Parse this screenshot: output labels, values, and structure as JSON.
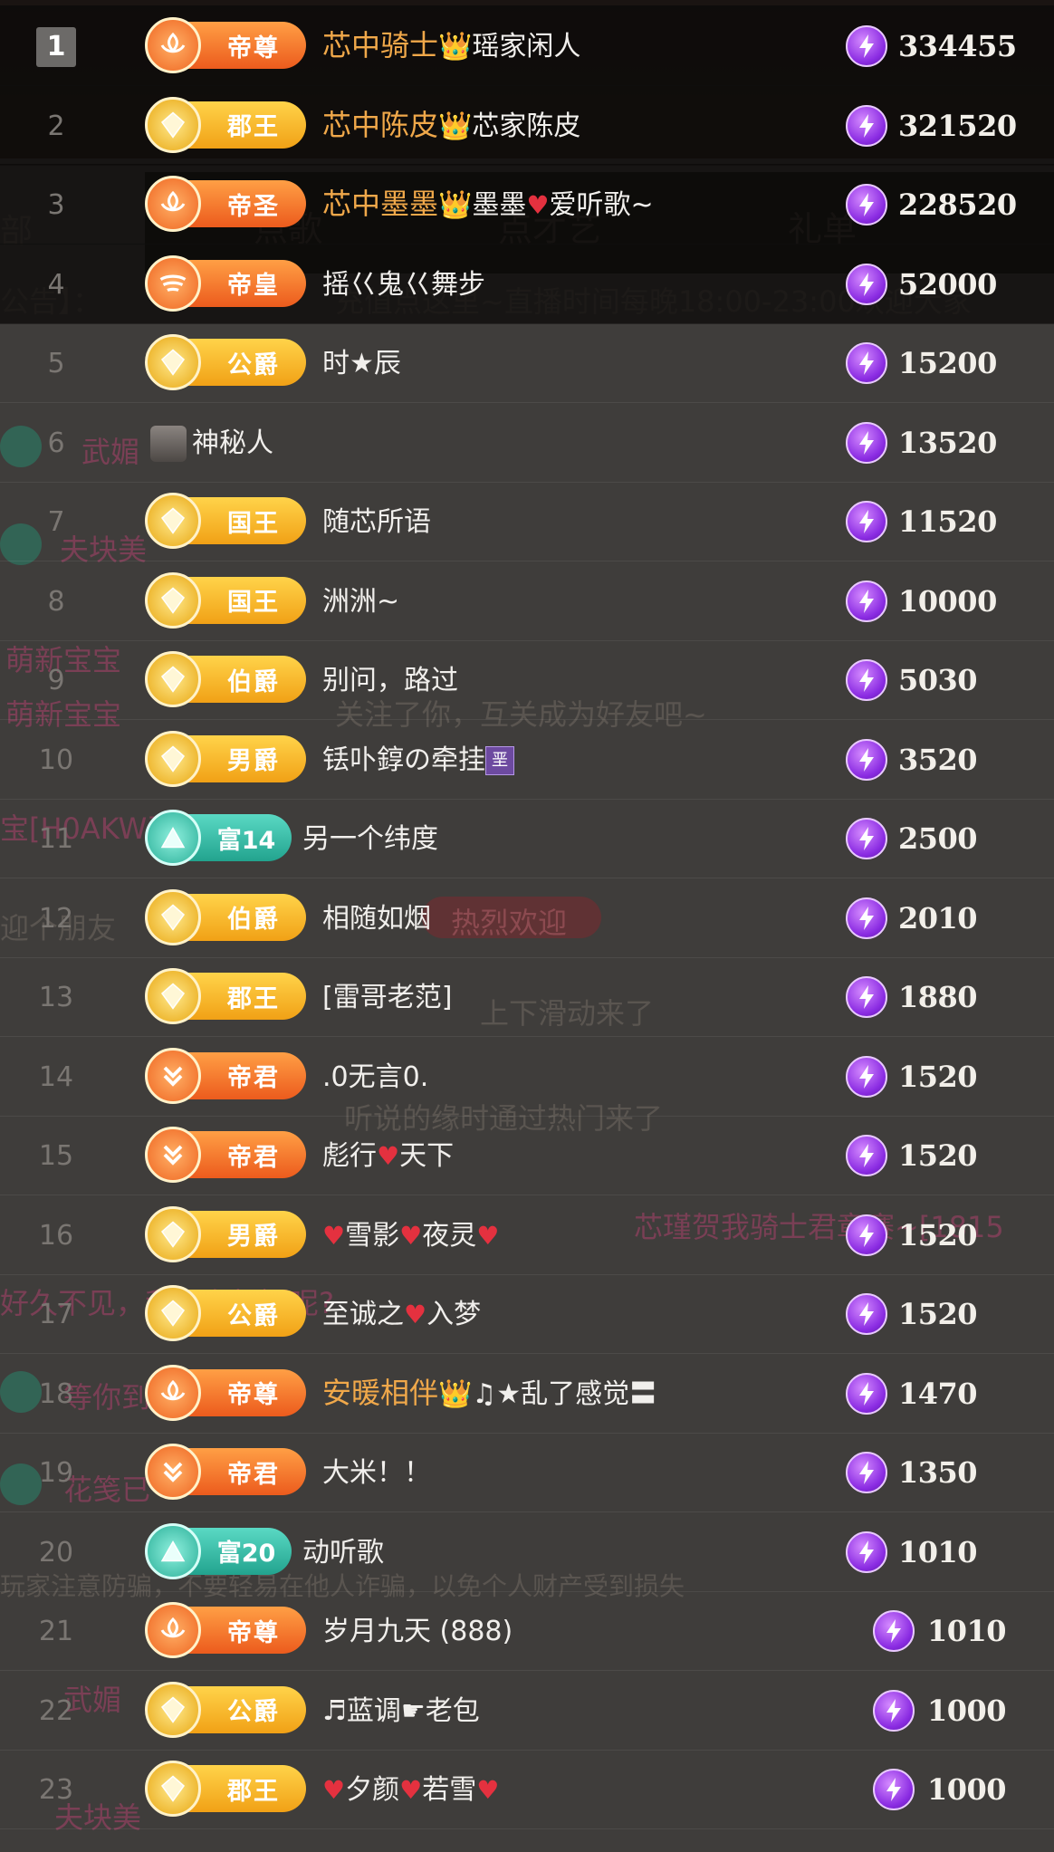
{
  "background": {
    "tabs": [
      "部",
      "点歌",
      "点才艺",
      "礼单"
    ],
    "fragments": [
      "公告】：",
      "充值点这里~直播时间每晚18:00-23:00欢迎大家",
      "1",
      "武媚",
      "2",
      "夫块美",
      "萌新宝宝",
      "萌新宝宝",
      "关注了你，互关成为好友吧~",
      "宝[H0AKW]",
      "迎个朋友",
      "热烈欢迎",
      "上下滑动来了",
      "听说的缘时通过热门来了",
      "芯瑾贺我骑士君章赛~[1815",
      "好久不见，我还在怀疑呢?",
      "等你到",
      "花笺已",
      "玩家注意防骗，不要轻易在他人诈骗，以免个人财产受到损失",
      "武媚",
      "夫块美"
    ]
  },
  "rows": [
    {
      "rank": "1",
      "badge": "帝尊",
      "tier": "orange",
      "emblem": "lotus-emblem-icon",
      "parts": [
        {
          "t": "芯中骑士",
          "c": "noble"
        },
        {
          "t": "👑",
          "c": "crown"
        },
        {
          "t": "瑶家闲人",
          "c": "nm"
        }
      ],
      "amount": "334455",
      "top": true
    },
    {
      "rank": "2",
      "badge": "郡王",
      "tier": "gold",
      "emblem": "crown-emblem-icon",
      "parts": [
        {
          "t": "芯中陈皮",
          "c": "noble"
        },
        {
          "t": "👑",
          "c": "crown"
        },
        {
          "t": "芯家陈皮",
          "c": "nm"
        }
      ],
      "amount": "321520",
      "top": true
    },
    {
      "rank": "3",
      "badge": "帝圣",
      "tier": "orange",
      "emblem": "lotus-emblem-icon",
      "parts": [
        {
          "t": "芯中墨墨",
          "c": "noble"
        },
        {
          "t": "👑",
          "c": "crown"
        },
        {
          "t": "墨墨",
          "c": "nm"
        },
        {
          "t": "♥",
          "c": "heart"
        },
        {
          "t": "爱听歌~",
          "c": "nm"
        }
      ],
      "amount": "228520",
      "top": true
    },
    {
      "rank": "4",
      "badge": "帝皇",
      "tier": "orange",
      "emblem": "wing-emblem-icon",
      "parts": [
        {
          "t": "摇巜鬼巜舞步",
          "c": "nm"
        }
      ],
      "amount": "52000",
      "top": true
    },
    {
      "rank": "5",
      "badge": "公爵",
      "tier": "gold",
      "emblem": "gem-emblem-icon",
      "parts": [
        {
          "t": "时★辰",
          "c": "nm"
        }
      ],
      "amount": "15200"
    },
    {
      "rank": "6",
      "badge": "",
      "tier": "",
      "emblem": "",
      "parts": [
        {
          "t": "神秘人",
          "c": "nm"
        }
      ],
      "amount": "13520"
    },
    {
      "rank": "7",
      "badge": "国王",
      "tier": "gold",
      "emblem": "gem-emblem-icon",
      "parts": [
        {
          "t": "随芯所语",
          "c": "nm"
        }
      ],
      "amount": "11520"
    },
    {
      "rank": "8",
      "badge": "国王",
      "tier": "gold",
      "emblem": "gem-emblem-icon",
      "parts": [
        {
          "t": "洲洲~",
          "c": "nm"
        }
      ],
      "amount": "10000"
    },
    {
      "rank": "9",
      "badge": "伯爵",
      "tier": "gold",
      "emblem": "gem-emblem-icon",
      "parts": [
        {
          "t": "别问，路过",
          "c": "nm"
        }
      ],
      "amount": "5030"
    },
    {
      "rank": "10",
      "badge": "男爵",
      "tier": "gold",
      "emblem": "gem-emblem-icon",
      "parts": [
        {
          "t": "铥卟錞の牵挂",
          "c": "nm"
        },
        {
          "t": "垩",
          "c": "tagbox"
        }
      ],
      "amount": "3520"
    },
    {
      "rank": "11",
      "badge": "富14",
      "tier": "teal",
      "emblem": "triangle-emblem-icon",
      "parts": [
        {
          "t": "另一个纬度",
          "c": "nm"
        }
      ],
      "amount": "2500"
    },
    {
      "rank": "12",
      "badge": "伯爵",
      "tier": "gold",
      "emblem": "gem-emblem-icon",
      "parts": [
        {
          "t": "相随如烟",
          "c": "nm"
        }
      ],
      "amount": "2010"
    },
    {
      "rank": "13",
      "badge": "郡王",
      "tier": "gold",
      "emblem": "gem-emblem-icon",
      "parts": [
        {
          "t": "[雷哥老范]",
          "c": "nm"
        }
      ],
      "amount": "1880"
    },
    {
      "rank": "14",
      "badge": "帝君",
      "tier": "orange",
      "emblem": "chevron-emblem-icon",
      "parts": [
        {
          "t": ".0无言0.",
          "c": "nm"
        }
      ],
      "amount": "1520"
    },
    {
      "rank": "15",
      "badge": "帝君",
      "tier": "orange",
      "emblem": "chevron-emblem-icon",
      "parts": [
        {
          "t": "彪行",
          "c": "nm"
        },
        {
          "t": "♥",
          "c": "heart"
        },
        {
          "t": "天下",
          "c": "nm"
        }
      ],
      "amount": "1520"
    },
    {
      "rank": "16",
      "badge": "男爵",
      "tier": "gold",
      "emblem": "gem-emblem-icon",
      "parts": [
        {
          "t": "♥",
          "c": "heart"
        },
        {
          "t": "雪影",
          "c": "nm"
        },
        {
          "t": "♥",
          "c": "heart"
        },
        {
          "t": "夜灵",
          "c": "nm"
        },
        {
          "t": "♥",
          "c": "heart"
        }
      ],
      "amount": "1520"
    },
    {
      "rank": "17",
      "badge": "公爵",
      "tier": "gold",
      "emblem": "gem-emblem-icon",
      "parts": [
        {
          "t": "至诚之",
          "c": "nm"
        },
        {
          "t": "♥",
          "c": "heart"
        },
        {
          "t": "入梦",
          "c": "nm"
        }
      ],
      "amount": "1520"
    },
    {
      "rank": "18",
      "badge": "帝尊",
      "tier": "orange",
      "emblem": "lotus-emblem-icon",
      "parts": [
        {
          "t": "安暖相伴",
          "c": "noble"
        },
        {
          "t": "👑",
          "c": "crown"
        },
        {
          "t": "♫★乱了感觉〓",
          "c": "nm"
        }
      ],
      "amount": "1470"
    },
    {
      "rank": "19",
      "badge": "帝君",
      "tier": "orange",
      "emblem": "chevron-emblem-icon",
      "parts": [
        {
          "t": "大米！！",
          "c": "nm"
        }
      ],
      "amount": "1350"
    },
    {
      "rank": "20",
      "badge": "富20",
      "tier": "teal",
      "emblem": "triangle-emblem-icon",
      "parts": [
        {
          "t": "动听歌",
          "c": "nm"
        }
      ],
      "amount": "1010"
    },
    {
      "rank": "21",
      "badge": "帝尊",
      "tier": "orange",
      "emblem": "lotus-emblem-icon",
      "parts": [
        {
          "t": "岁月九天 (888)",
          "c": "nm"
        }
      ],
      "amount": "1010"
    },
    {
      "rank": "22",
      "badge": "公爵",
      "tier": "gold",
      "emblem": "gem-emblem-icon",
      "parts": [
        {
          "t": "♬蓝调☛老包",
          "c": "nm"
        }
      ],
      "amount": "1000"
    },
    {
      "rank": "23",
      "badge": "郡王",
      "tier": "gold",
      "emblem": "gem-emblem-icon",
      "parts": [
        {
          "t": "♥",
          "c": "heart"
        },
        {
          "t": "夕颜",
          "c": "nm"
        },
        {
          "t": "♥",
          "c": "heart"
        },
        {
          "t": "若雪",
          "c": "nm"
        },
        {
          "t": "♥",
          "c": "heart"
        }
      ],
      "amount": "1000"
    }
  ],
  "icons": {
    "coin": "lightning-coin-icon",
    "avatar": "mystery-avatar-icon"
  }
}
